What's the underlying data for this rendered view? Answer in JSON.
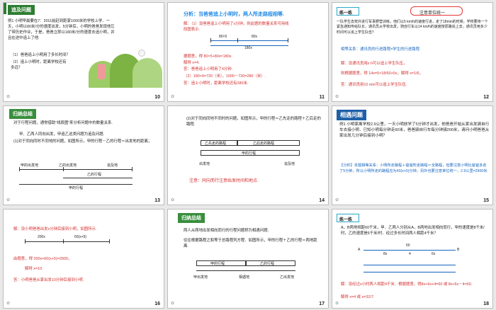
{
  "slides": [
    {
      "number": "10",
      "title": "追及问题",
      "example": "例1  小明早晨要在7：20以前赶到距家1000米的学校上学．一天，小明以80米/分的速度出发，5分钟后，小明的爸爸发现他忘了带历史作业，于是，爸爸立即以180米/分的速度去追小明，并且在途中追上了他.",
      "q1": "（1）爸爸追上小明用了多长时间？",
      "q2": "（2）追上小明时，距离学校还有多远？"
    },
    {
      "number": "11",
      "heading": "分析：当爸爸追上小明时，两人所走路程相等.",
      "solution": "解：（1）设爸爸追上小明用了x分钟，则此题的数量关系可用线段图表示.",
      "label_80x5": "80×5",
      "label_80x": "80x",
      "label_180x": "180x",
      "eq": "据题意，得 80×5+80x=180x.",
      "solve": "解得        x=4.",
      "ans1": "答：爸爸追上小明用了4分钟.",
      "calc2": "（2）180×4=720（米），1000－720=280（米）.",
      "ans2": "答：追上小明时，距离学校还有280米."
    },
    {
      "number": "12",
      "title": "练一练",
      "note": "注意单位统一",
      "problem": "一队学生去校外进行军事野营训练，他们以5 km/h的速度行进，走了18min的时候，学校要将一个紧急通知传给队长，通讯员从学校出发，骑自行车以14 km/h的速度按原路追上去，通讯员用多少时间可以追上学生队伍？",
      "hint": "相等关系：通讯员的行进路程=学生的行进路程.",
      "sol": "解：设通讯员用x h可以追上学生队伍，",
      "eq": "则根据题意，得 14x=5×18/60+5x，解得 x=1/6，",
      "ans": "答：通讯员用10 min可以追上学生队伍."
    },
    {
      "number": "13",
      "title": "归纳总结",
      "p1": "对于行程问题，通常借助“线段图”来分析问题中的数量关系.",
      "p2": "甲、乙两人同向出发，甲追乙这类问题为追及问题.",
      "p3": "(1)对于同向同时不同地的问题，如图所示，甲的行程－乙的行程＝出发地的距离；",
      "lbl_jia_start": "甲的出发地",
      "lbl_yi_start": "乙的出发地",
      "lbl_catch": "追及地",
      "lbl_yi_path": "乙的行程",
      "lbl_jia_path": "甲的行程"
    },
    {
      "number": "14",
      "p1": "(2)对于同向同地不同时的问题，如图所示，甲的行程＝乙先走的路程＋乙后走的路程.",
      "lbl_first": "乙先走的路程",
      "lbl_after": "乙后走的路程",
      "lbl_jia_path": "甲的行程",
      "lbl_start": "出发地",
      "lbl_catch": "追及地",
      "note": "注意：同向而行注意始发时间和地点."
    },
    {
      "number": "15",
      "title": "相遇问题",
      "example": "例1  小明家离学校2.9公里，一天小明放学了5分钟才出发，他爸爸开始从家出发骑自行车去接小明．已知小明每分钟走60米，爸爸骑自行车每分钟骑200米，请问小明爸爸从家出发几分钟后接到小明？",
      "analysis": "【分析】本题相等关系：小明所走路程＋爸爸所走路程＝全路程，但要注意小明比爸爸多走了5分钟，所以小明所走的路程应为60(x+5)分钟，另外也要注意单位统一，2.9公里=2900米."
    },
    {
      "number": "16",
      "sol": "解：设小明爸爸出发x分钟后接到小明，如图所示.",
      "lbl_a": "200x",
      "lbl_b": "60(x+5)",
      "eq": "由题意，得 200x+60(x+5)=2900，",
      "solve": "解得  x=10.",
      "ans": "答：小明爸爸从家出发10分钟后接到小明."
    },
    {
      "number": "17",
      "title": "归纳总结",
      "p1": "两人从两地出发相向而行的行程问题称为相遇问题.",
      "p2": "往往根据路程之和等于总路程列方程．如图所示，甲的行程＋乙的行程＝两地距离.",
      "lbl_jia_path": "甲的行程",
      "lbl_yi_path": "乙的行程",
      "lbl_jia_start": "甲出发地",
      "lbl_meet": "相遇地",
      "lbl_yi_start": "乙出发地"
    },
    {
      "number": "18",
      "title": "练一练",
      "problem": "A，B两地相距60千米，甲、乙两人分别从A，B两地出发相向而行，甲的速度是8千米/时，乙的速度是6千米/时．经过多长时间两人相距4千米？",
      "lbl_60": "60",
      "lbl_8x": "8x",
      "lbl_4": "4",
      "lbl_6x": "6x",
      "lbl_A": "A",
      "lbl_B": "B",
      "sol": "解：设经过x小时两人相距4千米．根据题意，得8x+6x+4=60 或 8x+6x－4=60.",
      "solve": "解得 x=4 或 x=32/7."
    }
  ]
}
